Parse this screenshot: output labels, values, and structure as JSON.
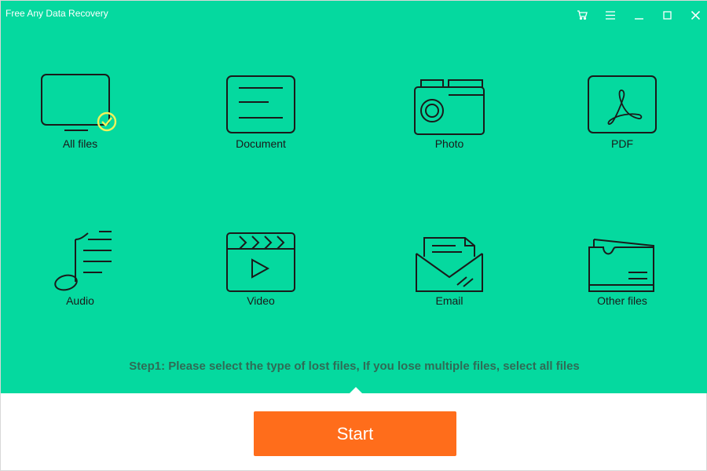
{
  "window": {
    "title": "Free Any Data Recovery"
  },
  "titlebar_icons": [
    "cart-icon",
    "menu-icon",
    "minimize-icon",
    "maximize-icon",
    "close-icon"
  ],
  "file_types": [
    {
      "label": "All files",
      "icon": "monitor-check-icon",
      "selected": true
    },
    {
      "label": "Document",
      "icon": "document-icon",
      "selected": false
    },
    {
      "label": "Photo",
      "icon": "camera-icon",
      "selected": false
    },
    {
      "label": "PDF",
      "icon": "pdf-icon",
      "selected": false
    },
    {
      "label": "Audio",
      "icon": "music-note-icon",
      "selected": false
    },
    {
      "label": "Video",
      "icon": "clapperboard-icon",
      "selected": false
    },
    {
      "label": "Email",
      "icon": "envelope-icon",
      "selected": false
    },
    {
      "label": "Other files",
      "icon": "folder-icon",
      "selected": false
    }
  ],
  "instruction": "Step1: Please select the type of lost files, If you lose multiple files, select all files",
  "start_button": {
    "label": "Start"
  },
  "colors": {
    "accent_green": "#05d99f",
    "start_orange": "#ff6d1b",
    "check_yellow": "#f2f25a",
    "icon_stroke": "#1a1a1a"
  }
}
